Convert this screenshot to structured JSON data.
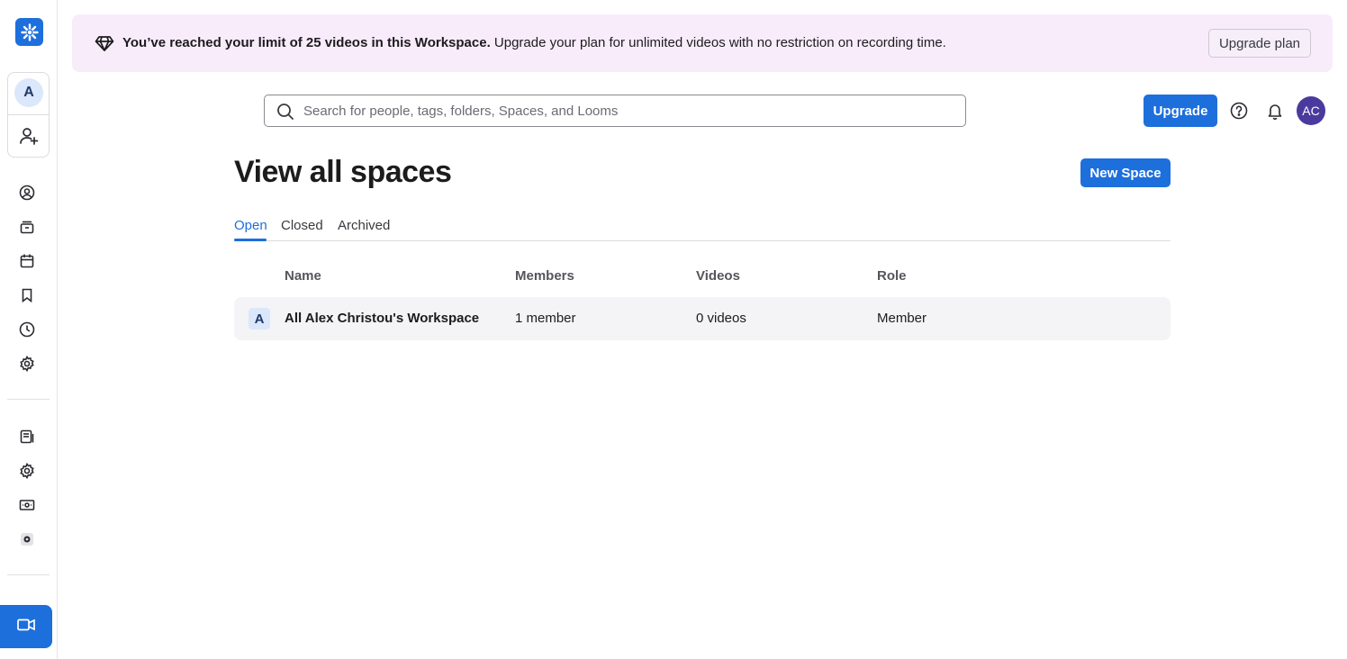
{
  "banner": {
    "bold_text": "You’ve reached your limit of 25 videos in this Workspace.",
    "text": " Upgrade your plan for unlimited videos with no restriction on recording time.",
    "upgrade_plan_label": "Upgrade plan",
    "icon": "diamond-icon"
  },
  "sidebar": {
    "workspace_initial": "A",
    "icons": [
      "home-icon",
      "library-icon",
      "calendar-icon",
      "bookmark-icon",
      "history-icon",
      "settings-icon",
      "notes-icon",
      "admin-settings-icon",
      "billing-icon",
      "app-settings-icon"
    ],
    "record_icon": "video-camera-icon"
  },
  "topbar": {
    "search_placeholder": "Search for people, tags, folders, Spaces, and Looms",
    "upgrade_label": "Upgrade",
    "user_initials": "AC"
  },
  "main": {
    "title": "View all spaces",
    "new_space_label": "New Space",
    "tabs": [
      {
        "label": "Open",
        "active": true
      },
      {
        "label": "Closed",
        "active": false
      },
      {
        "label": "Archived",
        "active": false
      }
    ],
    "columns": [
      "Name",
      "Members",
      "Videos",
      "Role"
    ],
    "rows": [
      {
        "initial": "A",
        "name": "All Alex Christou's Workspace",
        "members": "1 member",
        "videos": "0 videos",
        "role": "Member"
      }
    ]
  },
  "colors": {
    "accent": "#1d6fdc",
    "banner_bg": "#f8ecfb",
    "avatar": "#4b3a9e"
  }
}
